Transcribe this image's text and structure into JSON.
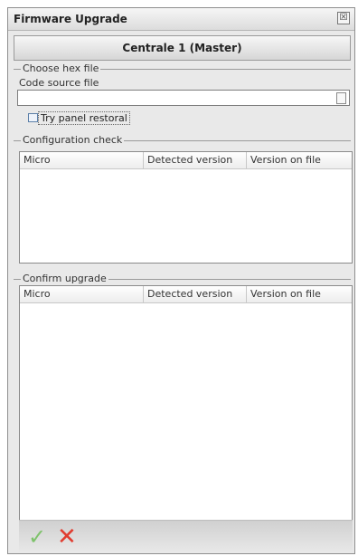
{
  "window": {
    "title": "Firmware Upgrade",
    "close_glyph": "☒"
  },
  "node_button": {
    "label": "Centrale 1 (Master)"
  },
  "hex_section": {
    "title": "Choose hex file",
    "code_label": "Code source file",
    "code_value": "",
    "try_restoral_label": "Try panel restoral",
    "try_restoral_checked": false
  },
  "config_check": {
    "title": "Configuration check",
    "columns": [
      "Micro",
      "Detected version",
      "Version on file"
    ],
    "rows": []
  },
  "confirm_upgrade": {
    "title": "Confirm upgrade",
    "columns": [
      "Micro",
      "Detected version",
      "Version on file"
    ],
    "rows": []
  },
  "footer": {
    "ok_icon": "check-icon",
    "cancel_icon": "close-icon",
    "ok_glyph": "✓",
    "cancel_glyph": "✕"
  }
}
